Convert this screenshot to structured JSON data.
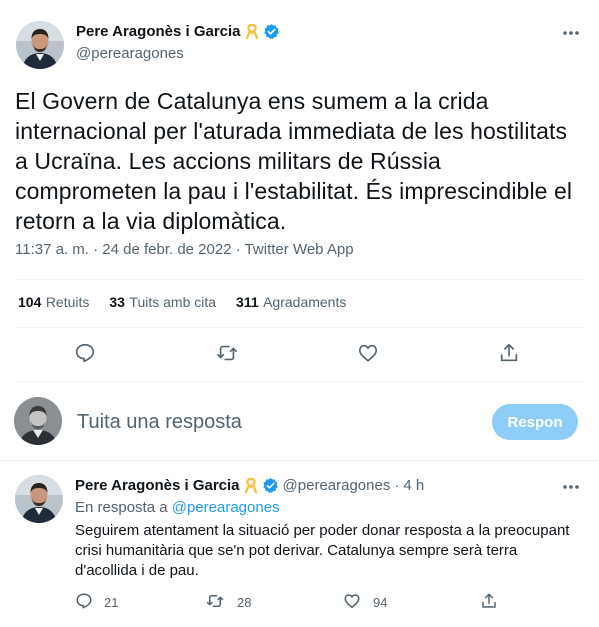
{
  "main_tweet": {
    "author_name": "Pere Aragonès i Garcia",
    "author_handle": "@perearagones",
    "text": "El Govern de Catalunya ens sumem a la crida internacional per l'aturada immediata de les hostilitats a Ucraïna. Les accions militars de Rússia comprometen la pau i l'estabilitat. És imprescindible el retorn a la via diplomàtica.",
    "timestamp": "11:37 a. m. · 24 de febr. de 2022 · Twitter Web App",
    "stats": {
      "retweets_count": "104",
      "retweets_label": "Retuits",
      "quotes_count": "33",
      "quotes_label": "Tuits amb cita",
      "likes_count": "311",
      "likes_label": "Agradaments"
    },
    "more_icon": "more-horizontal-icon",
    "badge_icons": [
      "yellow-ribbon-icon",
      "verified-badge-icon"
    ]
  },
  "composer": {
    "placeholder": "Tuita una resposta",
    "button_label": "Respon"
  },
  "reply_tweet": {
    "author_name": "Pere Aragonès i Garcia",
    "author_handle": "@perearagones",
    "time_ago": "4 h",
    "in_reply_prefix": "En resposta a",
    "in_reply_handle": "@perearagones",
    "text": "Seguirem atentament la situació per poder donar resposta a la preocupant crisi humanitària que se'n pot derivar. Catalunya sempre serà terra d'acollida i de pau.",
    "reply_count": "21",
    "retweet_count": "28",
    "like_count": "94"
  },
  "colors": {
    "accent": "#1d9bf0",
    "button_disabled": "#8ecdf8",
    "muted_text": "#536471",
    "ribbon": "#f6c344"
  }
}
